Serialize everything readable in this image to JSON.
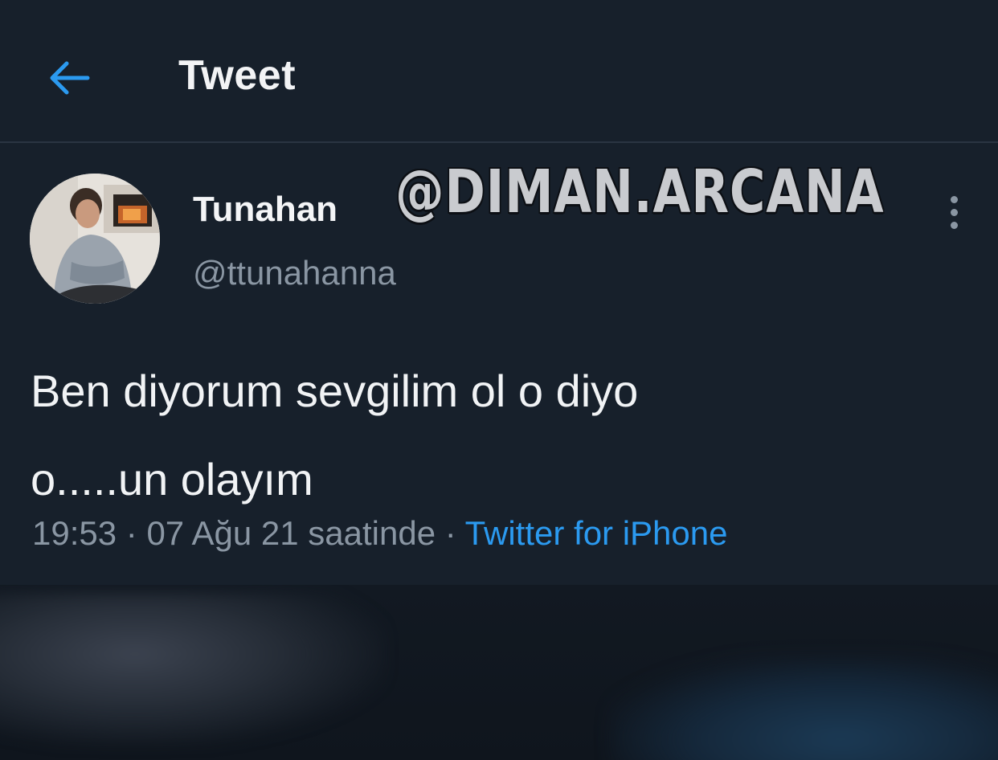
{
  "header": {
    "title": "Tweet",
    "back_icon": "arrow-left-icon"
  },
  "tweet": {
    "display_name": "Tunahan",
    "handle": "@ttunahanna",
    "watermark": "@DIMAN.ARCANA",
    "text_line_1": "Ben diyorum sevgilim ol o diyo",
    "text_line_2": "o.....un olayım",
    "time": "19:53",
    "separator_1": " · ",
    "date": "07 Ağu 21 saatinde",
    "separator_2": " · ",
    "source": "Twitter for iPhone",
    "more_icon": "more-vertical-icon"
  },
  "colors": {
    "background": "#151c26",
    "card": "#17202b",
    "primary_text": "#f1f3f5",
    "secondary_text": "#8a96a3",
    "accent": "#2b9af0"
  }
}
